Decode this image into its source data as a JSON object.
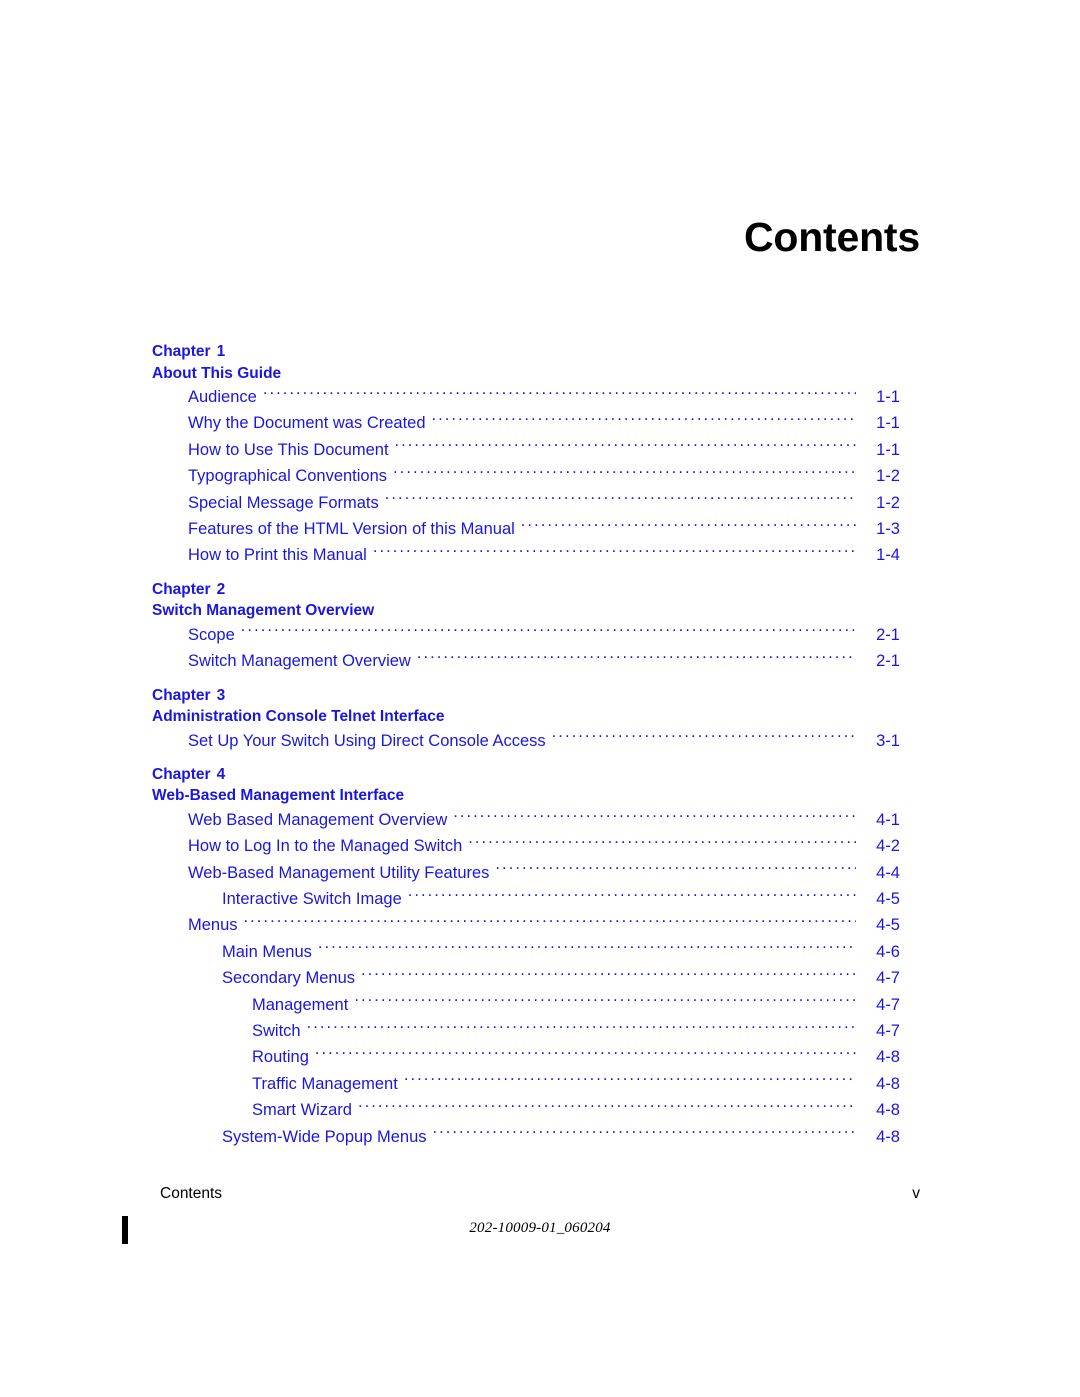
{
  "document": {
    "title": "Contents",
    "footer_left": "Contents",
    "footer_right": "v",
    "doc_number": "202-10009-01_060204",
    "link_color": "#1a16e0",
    "title_color": "#000000"
  },
  "toc": {
    "chapters": [
      {
        "label": "Chapter",
        "number": "1",
        "title": "About This Guide",
        "entries": [
          {
            "text": "Audience",
            "page": "1-1",
            "level": 1
          },
          {
            "text": "Why the Document was Created",
            "page": "1-1",
            "level": 1
          },
          {
            "text": "How to Use This Document",
            "page": "1-1",
            "level": 1
          },
          {
            "text": "Typographical Conventions",
            "page": "1-2",
            "level": 1
          },
          {
            "text": "Special Message Formats",
            "page": "1-2",
            "level": 1
          },
          {
            "text": "Features of the HTML Version of this Manual",
            "page": "1-3",
            "level": 1
          },
          {
            "text": "How to Print this Manual",
            "page": "1-4",
            "level": 1
          }
        ]
      },
      {
        "label": "Chapter",
        "number": "2",
        "title": "Switch Management Overview",
        "entries": [
          {
            "text": "Scope",
            "page": "2-1",
            "level": 1
          },
          {
            "text": "Switch Management Overview",
            "page": "2-1",
            "level": 1
          }
        ]
      },
      {
        "label": "Chapter",
        "number": "3",
        "title": "Administration Console Telnet Interface",
        "entries": [
          {
            "text": "Set Up Your Switch Using Direct Console Access",
            "page": "3-1",
            "level": 1
          }
        ]
      },
      {
        "label": "Chapter",
        "number": "4",
        "title": "Web-Based Management Interface",
        "entries": [
          {
            "text": "Web Based Management Overview",
            "page": "4-1",
            "level": 1
          },
          {
            "text": "How to Log In to the Managed Switch",
            "page": "4-2",
            "level": 1
          },
          {
            "text": "Web-Based Management Utility Features",
            "page": "4-4",
            "level": 1
          },
          {
            "text": "Interactive Switch Image",
            "page": "4-5",
            "level": 2
          },
          {
            "text": "Menus",
            "page": "4-5",
            "level": 1
          },
          {
            "text": "Main Menus",
            "page": "4-6",
            "level": 2
          },
          {
            "text": "Secondary Menus",
            "page": "4-7",
            "level": 2
          },
          {
            "text": "Management",
            "page": "4-7",
            "level": 3
          },
          {
            "text": "Switch",
            "page": "4-7",
            "level": 3
          },
          {
            "text": "Routing",
            "page": "4-8",
            "level": 3
          },
          {
            "text": "Traffic Management",
            "page": "4-8",
            "level": 3
          },
          {
            "text": "Smart Wizard",
            "page": "4-8",
            "level": 3
          },
          {
            "text": "System-Wide Popup Menus",
            "page": "4-8",
            "level": 2
          }
        ]
      }
    ]
  }
}
